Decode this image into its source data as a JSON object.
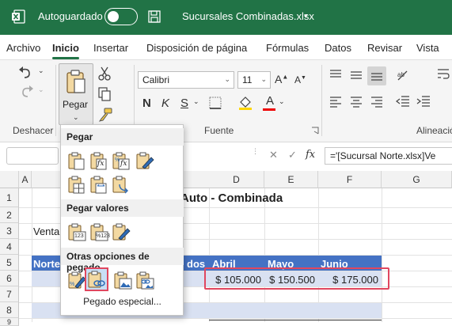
{
  "window": {
    "autosave_label": "Autoguardado",
    "filename": "Sucursales Combinadas.xlsx",
    "caret": "▾",
    "colors": {
      "titlebar": "#217346",
      "accent": "#217346"
    }
  },
  "tabs": [
    "Archivo",
    "Inicio",
    "Insertar",
    "Disposición de página",
    "Fórmulas",
    "Datos",
    "Revisar",
    "Vista"
  ],
  "ribbon": {
    "paste_label": "Pegar",
    "font_name": "Calibri",
    "font_size": "11",
    "groups": {
      "undo": "Deshacer",
      "font": "Fuente",
      "alignment": "Alineació"
    },
    "icons": [
      "undo-icon",
      "redo-icon",
      "paste-icon",
      "cut-icon",
      "copy-icon",
      "format-painter-icon",
      "bold-icon",
      "italic-icon",
      "underline-icon",
      "font-color-icon",
      "align-top-icon",
      "align-middle-icon",
      "align-bottom-icon"
    ]
  },
  "formula_bar": {
    "cancel": "✕",
    "confirm": "✓",
    "fx": "fx",
    "formula": "='[Sucursal Norte.xlsx]Ve"
  },
  "grid": {
    "columns": [
      "A",
      "D",
      "E",
      "F",
      "G"
    ],
    "rows": [
      "1",
      "2",
      "3",
      "4",
      "5",
      "6",
      "7",
      "8",
      "9"
    ],
    "title": "Auto - Combinada",
    "a3_text": "Venta",
    "row5_left": "Norte",
    "row5_mid": "dos",
    "months": [
      "Abril",
      "Mayo",
      "Junio"
    ],
    "values": [
      "$ 105.000",
      "$ 150.500",
      "$ 175.000"
    ],
    "colors": {
      "header": "#4472c4",
      "band": "#d9e1f2",
      "highlight": "#e0475f"
    }
  },
  "paste_menu": {
    "section_paste": "Pegar",
    "section_values": "Pegar valores",
    "section_other": "Otras opciones de pegado",
    "special": "Pegado especial...",
    "value_badges": [
      "123",
      "%123"
    ],
    "fx_badge": "fx"
  }
}
